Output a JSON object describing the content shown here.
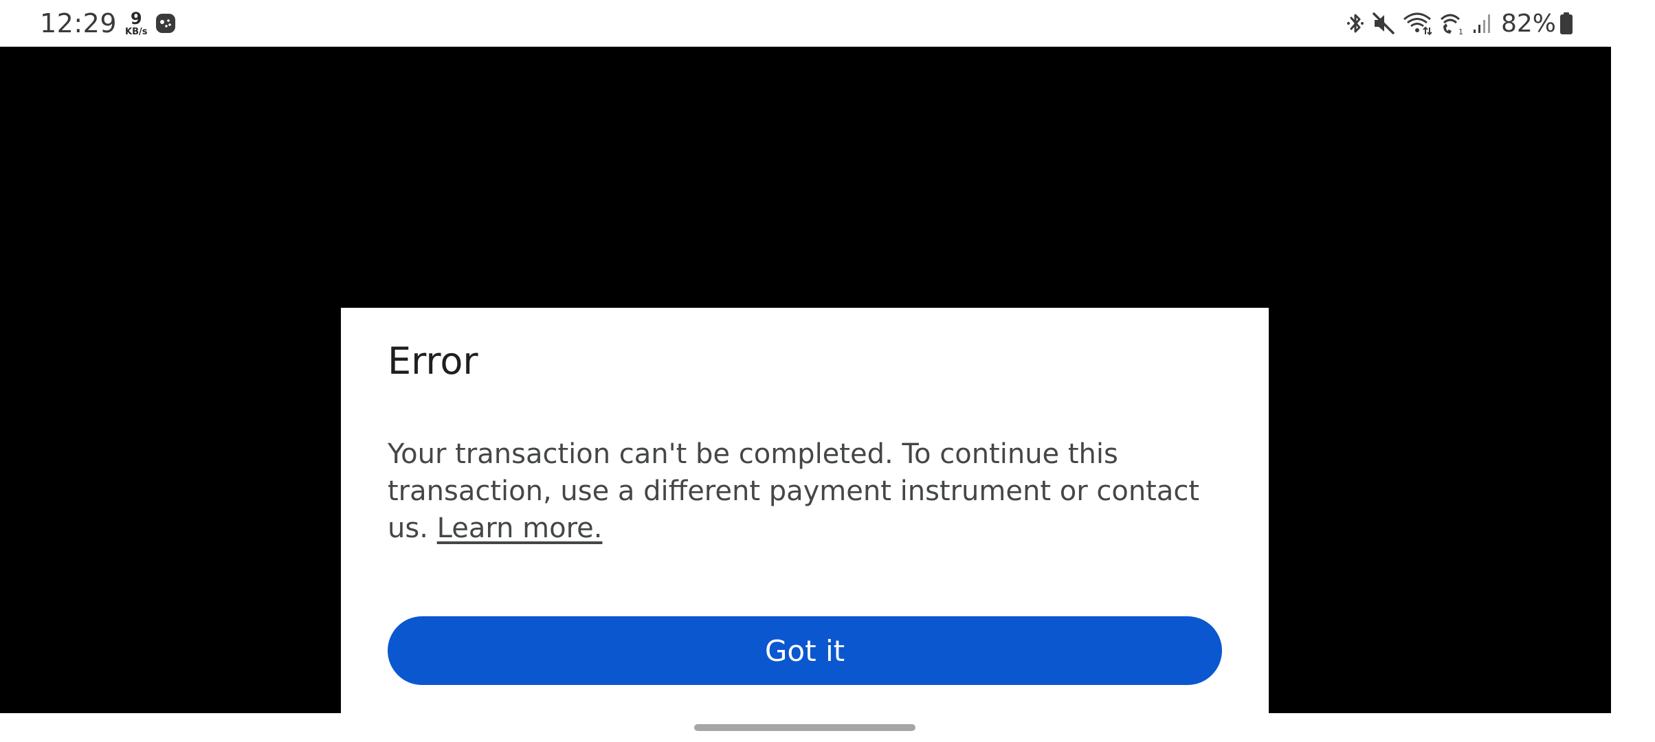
{
  "status_bar": {
    "time": "12:29",
    "net_speed_value": "9",
    "net_speed_unit": "KB/s",
    "battery_percent": "82%",
    "icons": [
      "game-launcher-icon",
      "bluetooth-icon",
      "mute-icon",
      "wifi-icon",
      "wifi-calling-icon",
      "signal-icon",
      "battery-icon"
    ]
  },
  "dialog": {
    "title": "Error",
    "message": "Your transaction can't be completed. To continue this transaction, use a different payment instrument or contact us.",
    "learn_more": "Learn more.",
    "button_label": "Got it",
    "button_color": "#0b57d0"
  },
  "colors": {
    "app_background": "#000000",
    "dialog_background": "#ffffff",
    "home_handle": "#a6a6a6"
  }
}
